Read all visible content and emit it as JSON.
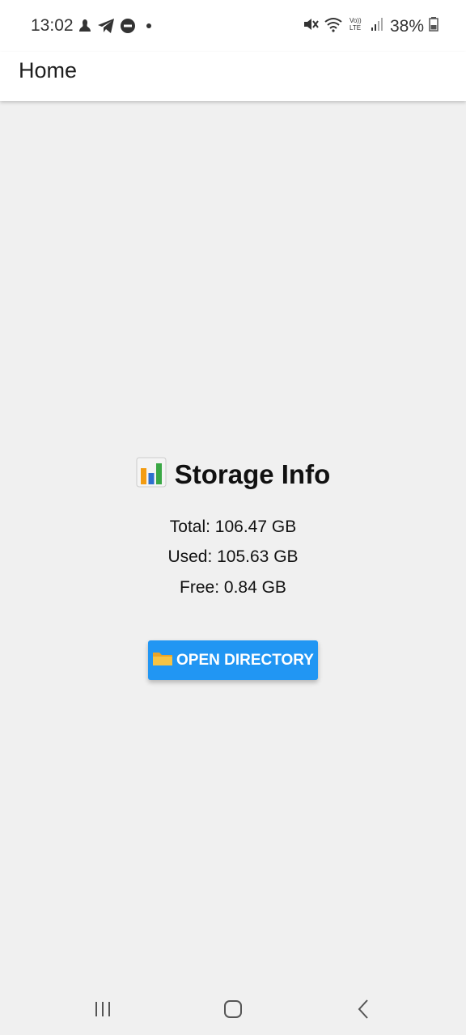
{
  "status_bar": {
    "time": "13:02",
    "battery": "38%",
    "left_icons": [
      "notification-icon",
      "telegram-icon",
      "dnd-icon",
      "dot-icon"
    ],
    "right_icons": [
      "mute-icon",
      "wifi-icon",
      "volte-icon",
      "signal-icon",
      "battery-icon"
    ],
    "volte_label": "Vo))\nLTE"
  },
  "app_bar": {
    "title": "Home"
  },
  "storage": {
    "heading": "Storage Info",
    "heading_icon": "bar-chart-icon",
    "total": "Total: 106.47 GB",
    "used": "Used: 105.63 GB",
    "free": "Free: 0.84 GB"
  },
  "actions": {
    "open_directory_label": "OPEN DIRECTORY",
    "open_directory_icon": "folder-icon",
    "button_color": "#2196f3"
  },
  "nav": {
    "recent_icon": "recent-apps-icon",
    "home_icon": "home-icon",
    "back_icon": "back-icon"
  }
}
